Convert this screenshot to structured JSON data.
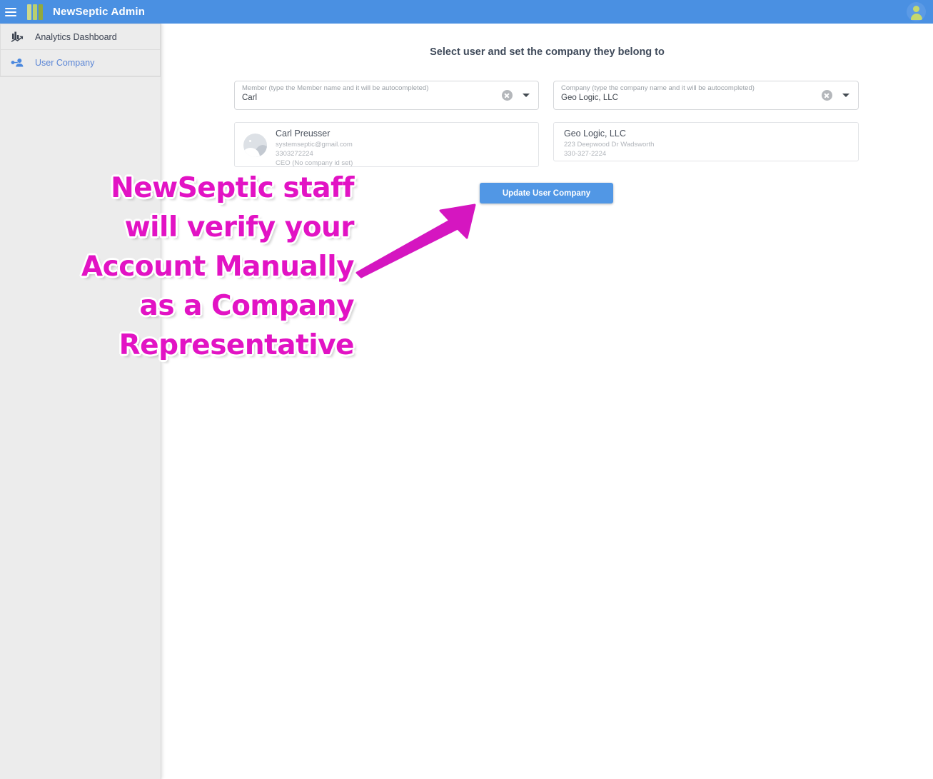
{
  "header": {
    "app_title": "NewSeptic Admin",
    "menu_icon": "hamburger-menu-icon",
    "logo_icon": "newseptic-bars-logo",
    "avatar_icon": "user-avatar-icon",
    "accent_color": "#4a90e2",
    "logo_colors": [
      "#cdd98a",
      "#b9cf6e",
      "#92a93c"
    ]
  },
  "sidebar": {
    "items": [
      {
        "label": "Analytics Dashboard",
        "icon": "analytics-chart-icon",
        "active": false
      },
      {
        "label": "User Company",
        "icon": "user-key-icon",
        "active": true
      }
    ],
    "active_color": "#5b86d6",
    "background": "#ececec"
  },
  "main": {
    "title": "Select user and set the company they belong to",
    "member_field": {
      "label": "Member (type the Member name and it will be autocompleted)",
      "value": "Carl",
      "placeholder": "Member (type the Member name and it will be autocompleted)",
      "clear_icon": "clear-circle-icon",
      "dropdown_icon": "chevron-down-icon"
    },
    "company_field": {
      "label": "Company (type the company name and it will be autocompleted)",
      "value": "Geo Logic, LLC",
      "placeholder": "Company (type the company name and it will be autocompleted)",
      "clear_icon": "clear-circle-icon",
      "dropdown_icon": "chevron-down-icon"
    },
    "user_card": {
      "avatar_icon": "image-placeholder-icon",
      "name": "Carl Preusser",
      "email": "systemseptic@gmail.com",
      "phone": "3303272224",
      "role": "CEO (No company id set)"
    },
    "company_card": {
      "name": "Geo Logic, LLC",
      "address": "223 Deepwood Dr Wadsworth",
      "phone": "330-327-2224"
    },
    "update_button": {
      "label": "Update User Company",
      "color": "#5197e5"
    }
  },
  "annotation": {
    "color": "#e213c4",
    "lines": [
      "NewSeptic staff",
      "will verify your",
      "Account Manually",
      "as a Company",
      "Representative"
    ],
    "arrow_icon": "pointer-arrow-icon"
  }
}
